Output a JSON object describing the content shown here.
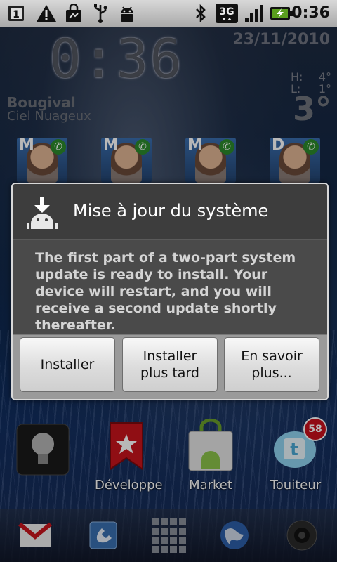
{
  "status_bar": {
    "notification_count": "1",
    "time": "0:36",
    "network": "3G",
    "icons": [
      "sim-notification-icon",
      "warning-icon",
      "shopping-bag-icon",
      "usb-icon",
      "android-debug-icon",
      "bluetooth-icon",
      "network-3g-icon",
      "signal-bars-icon",
      "battery-charging-icon"
    ]
  },
  "clock_widget": {
    "time": "0:36",
    "date": "23/11/2010",
    "city": "Bougival",
    "conditions": "Ciel Nuageux",
    "high_label": "H:",
    "high_value": "4°",
    "low_label": "L:",
    "low_value": "1°",
    "temperature": "3°"
  },
  "contacts": [
    {
      "letter": "M"
    },
    {
      "letter": "M"
    },
    {
      "letter": "M"
    },
    {
      "letter": "D"
    }
  ],
  "dialog": {
    "title": "Mise à jour du système",
    "message": "The first part of a two-part system update is ready to install. Your device will restart, and you will receive a second update shortly thereafter.",
    "buttons": {
      "install": "Installer",
      "install_later_line1": "Installer",
      "install_later_line2": "plus tard",
      "learn_more_line1": "En savoir",
      "learn_more_line2": "plus..."
    }
  },
  "home_apps": [
    {
      "label": "",
      "icon": "lightbulb-icon"
    },
    {
      "label": "Développe",
      "icon": "bookmark-star-icon"
    },
    {
      "label": "Market",
      "icon": "market-bag-icon"
    },
    {
      "label": "Touiteur",
      "icon": "twitter-bird-icon",
      "badge": "58"
    }
  ],
  "dock": {
    "icons": [
      "gmail-icon",
      "phone-icon",
      "app-drawer-icon",
      "browser-globe-icon",
      "camera-icon"
    ]
  },
  "colors": {
    "status_bar": "#bdbdbd",
    "dialog_body": "#4a4a4a",
    "dialog_footer": "#9a9a9a",
    "badge": "#c8101c"
  }
}
